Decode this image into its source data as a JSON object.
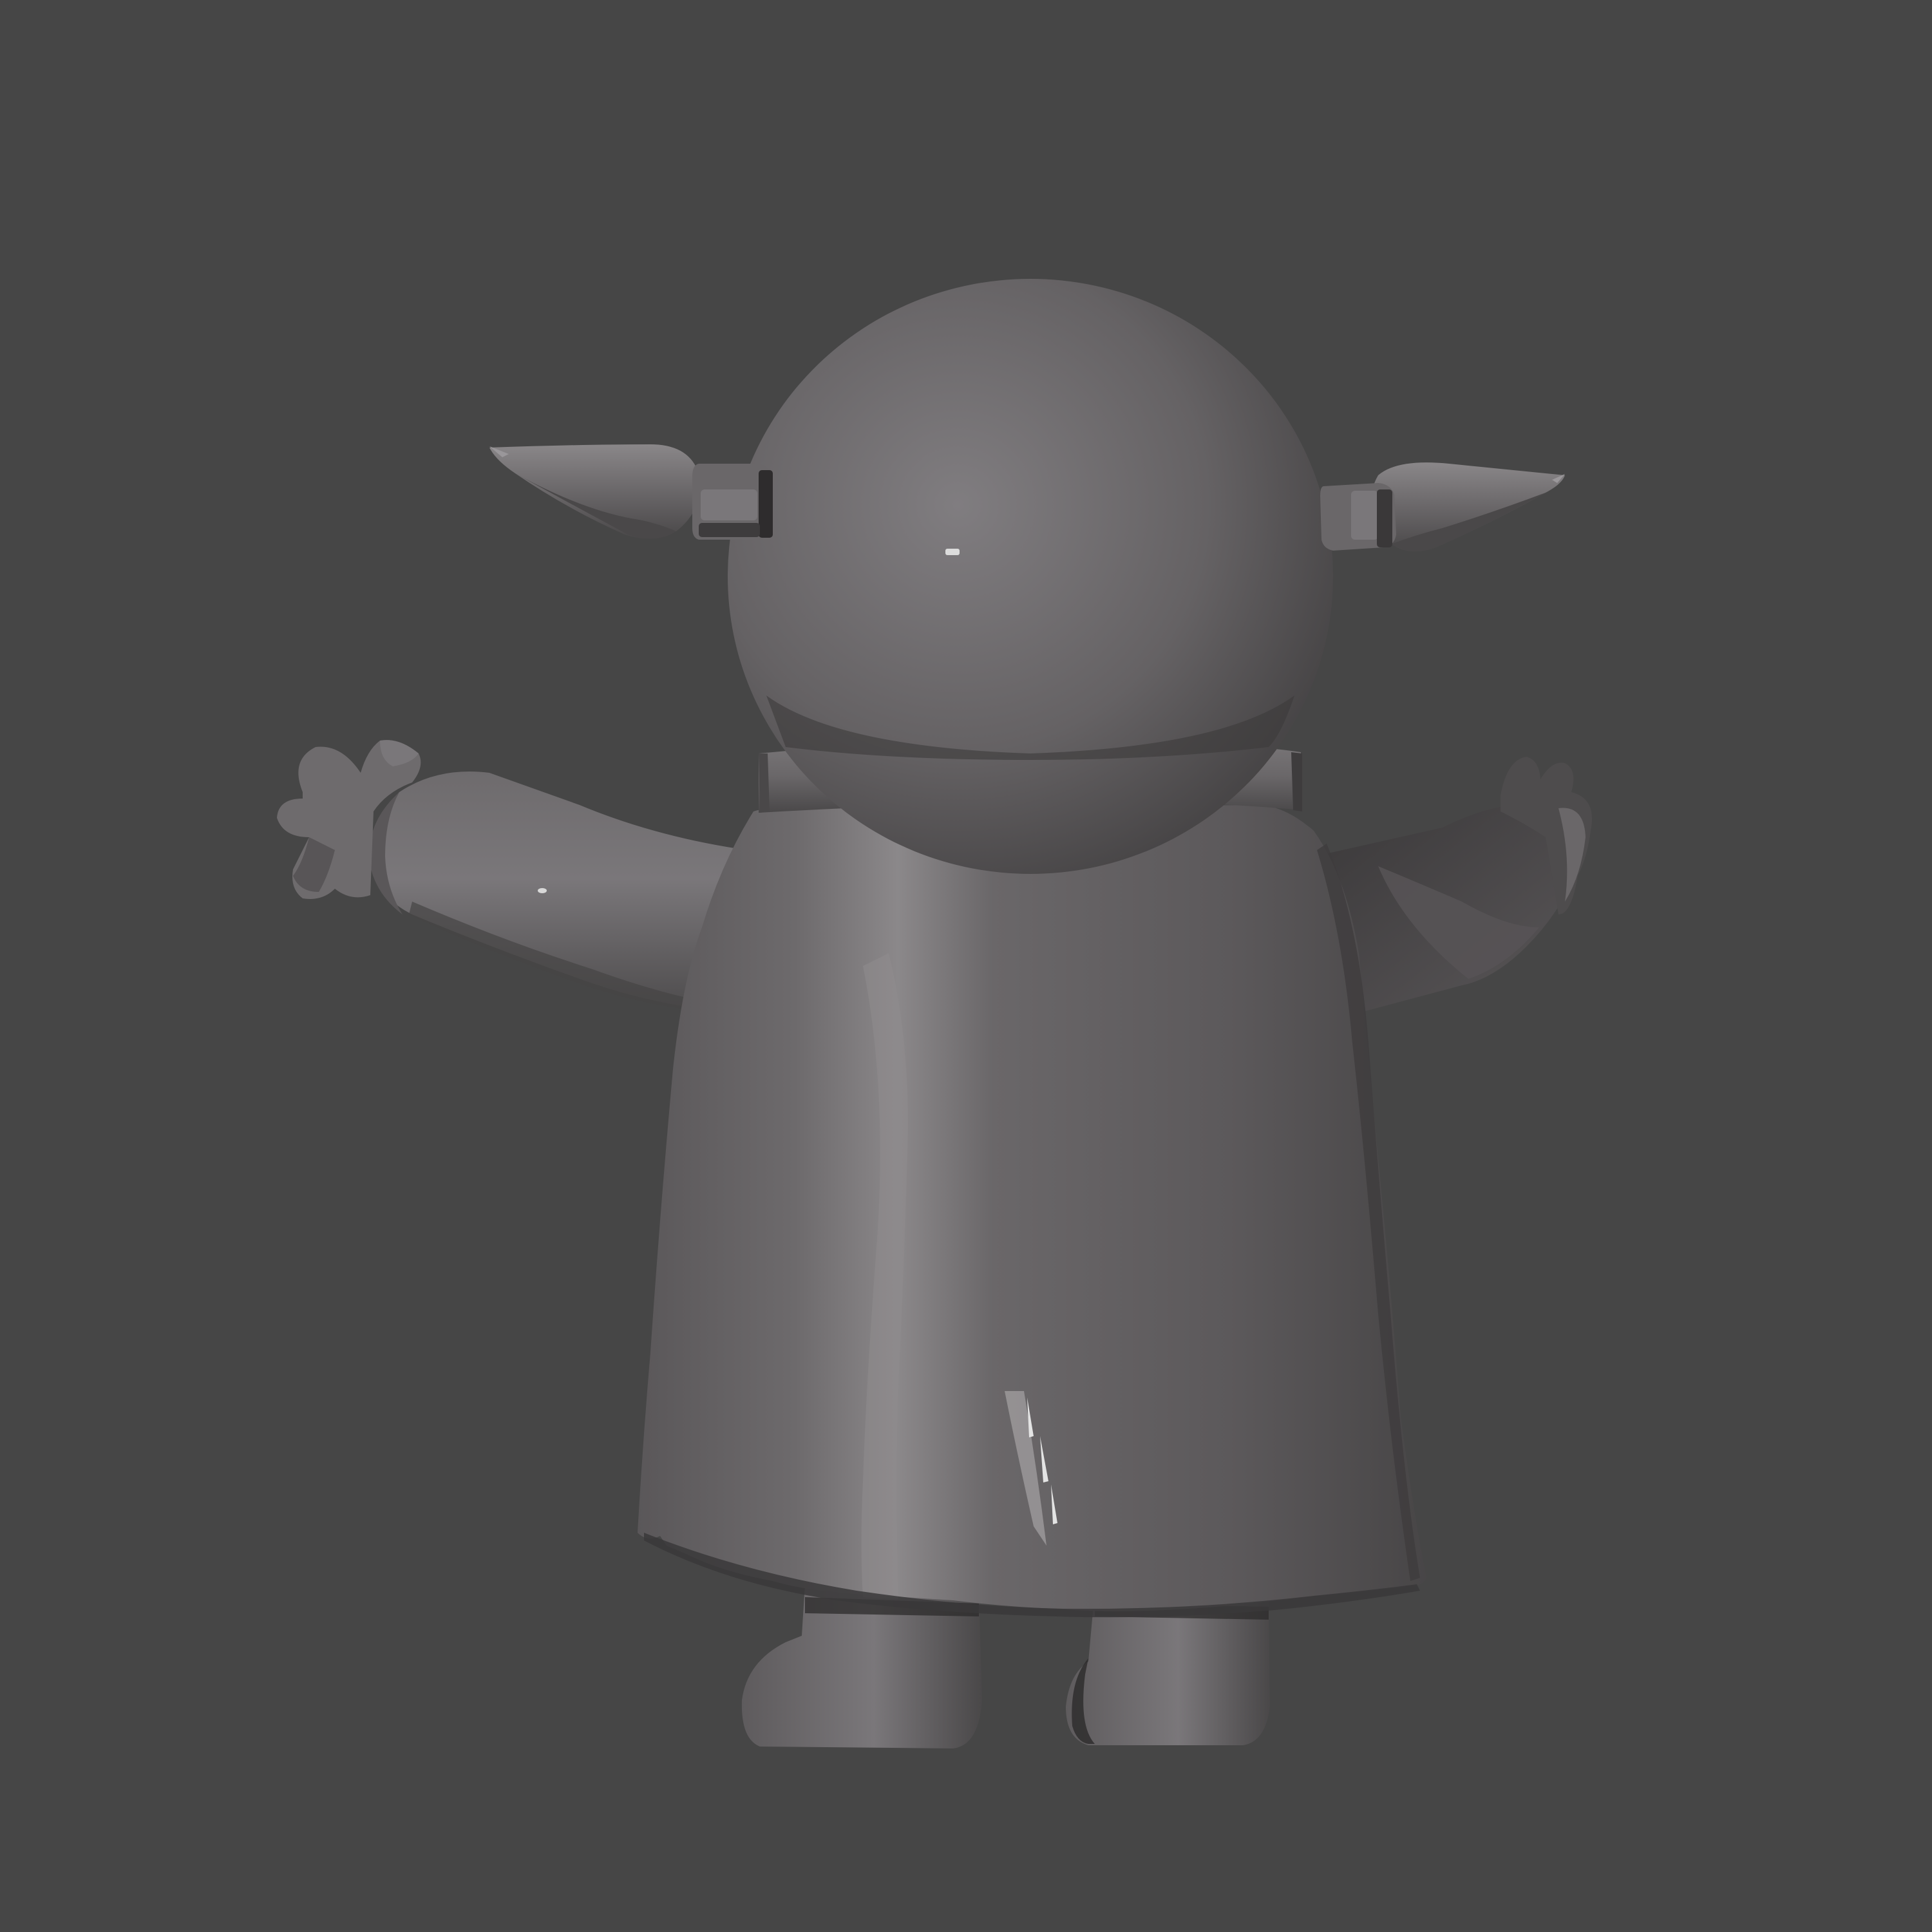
{
  "scene": {
    "background": "#464646",
    "subject": "3d-character-render",
    "palette": {
      "base": "#6a6769",
      "light": "#8a8789",
      "mid": "#5e5b5d",
      "dark": "#3c3a3b",
      "shadow": "#2c2b2b",
      "highlight": "#c8c8c8"
    }
  }
}
